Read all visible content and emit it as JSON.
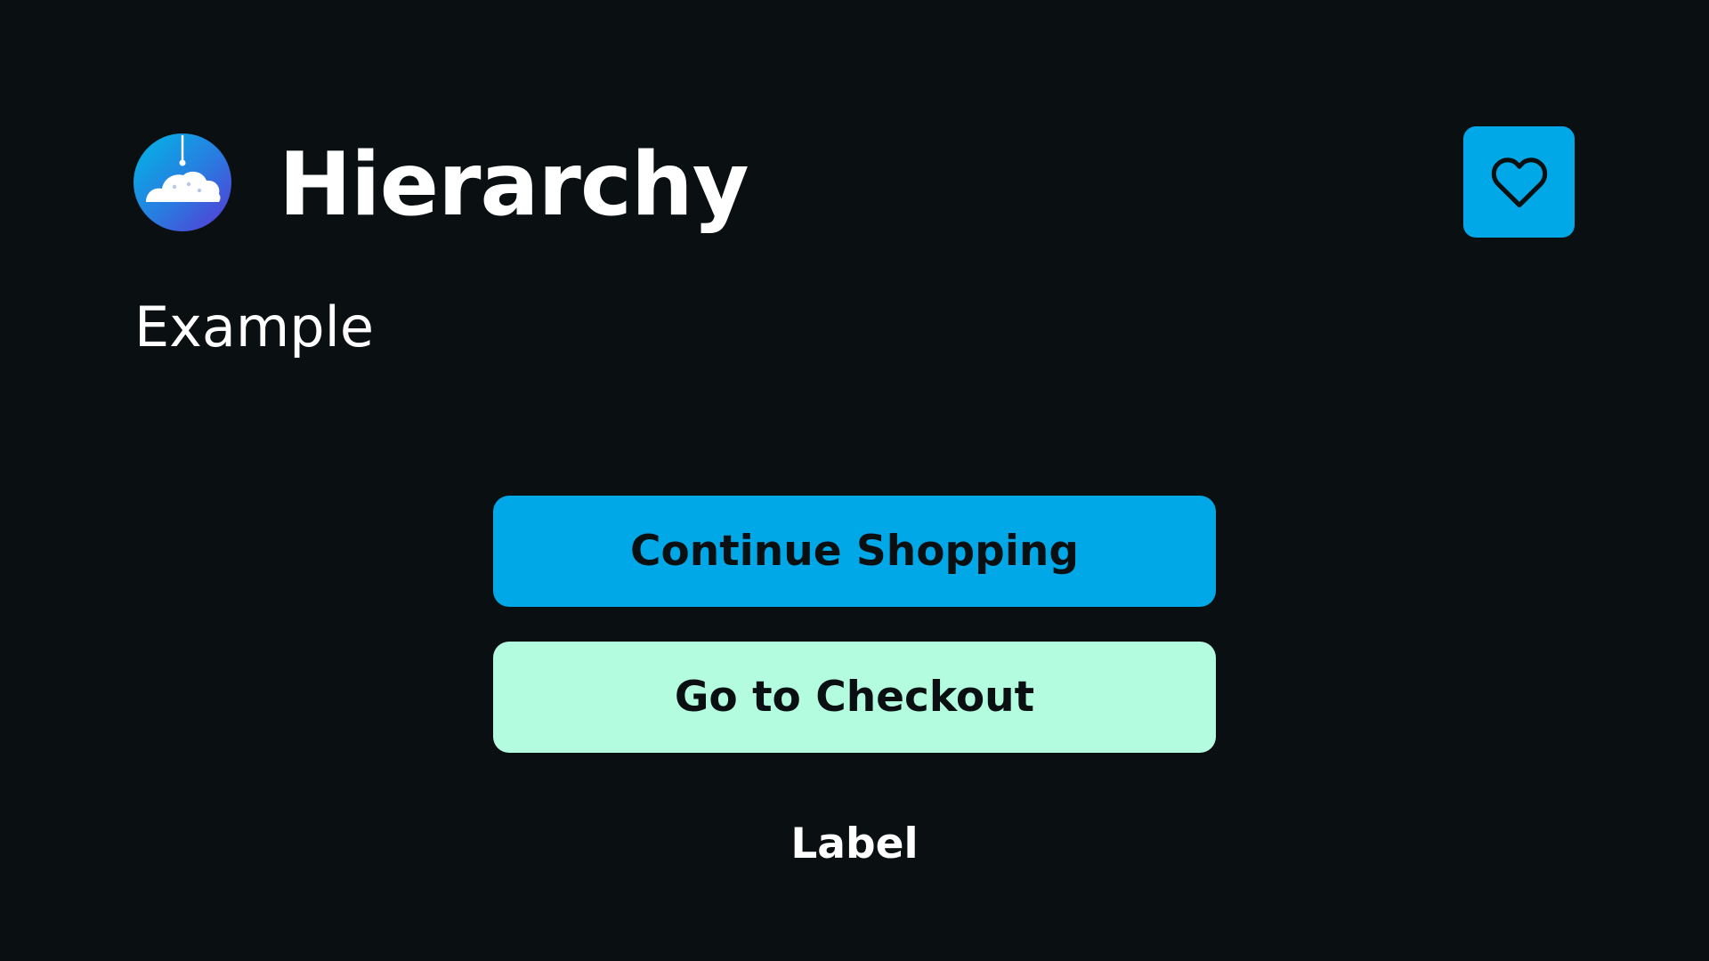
{
  "header": {
    "title": "Hierarchy",
    "subtitle": "Example",
    "logo_icon": "cloud-lamp-icon",
    "favorite_icon": "heart-icon"
  },
  "actions": {
    "primary_label": "Continue Shopping",
    "secondary_label": "Go to Checkout",
    "tertiary_label": "Label"
  },
  "colors": {
    "background": "#0a1011",
    "primary": "#00a8e8",
    "secondary": "#b3fcdf",
    "text_light": "#ffffff",
    "text_dark": "#0a1011",
    "logo_gradient_start": "#00b0e8",
    "logo_gradient_end": "#4a3fd6"
  }
}
